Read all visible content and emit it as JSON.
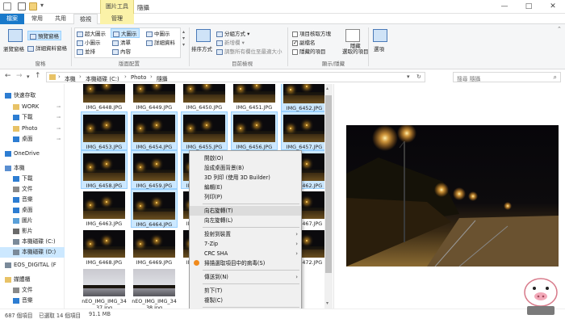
{
  "window": {
    "title": "隨攝",
    "context_tab": "圖片工具",
    "controls": [
      "—",
      "□",
      "✕"
    ]
  },
  "tabs": [
    {
      "label": "檔案"
    },
    {
      "label": "常用"
    },
    {
      "label": "共用"
    },
    {
      "label": "檢視"
    },
    {
      "label": "管理"
    }
  ],
  "ribbon": {
    "pane": {
      "nav_pane": "瀏覽窗格",
      "preview_pane": "預覽窗格",
      "details_pane": "詳細資料窗格",
      "group": "窗格"
    },
    "layout": {
      "options": [
        "超大圖示",
        "大圖示",
        "中圖示",
        "小圖示",
        "清單",
        "詳細資料",
        "並排",
        "內容"
      ],
      "selected": "大圖示",
      "group": "版面配置"
    },
    "current_view": {
      "sort_by": "排序方式",
      "group_by": "分組方式",
      "add_columns": "新增欄",
      "fit_columns": "調整所有欄位至最適大小",
      "group": "目前檢視"
    },
    "show_hide": {
      "item_checkboxes": "項目核取方塊",
      "file_extensions": "副檔名",
      "hidden_items": "隱藏的項目",
      "hide_selected": "隱藏\n選取的項目",
      "options": "選項",
      "group": "顯示/隱藏",
      "item_checkboxes_checked": false,
      "file_extensions_checked": true,
      "hidden_items_checked": false
    }
  },
  "address": {
    "path": [
      "本機",
      "本機磁碟 (C:)",
      "Photo",
      "隨攝"
    ],
    "search_placeholder": "搜尋 隨攝"
  },
  "nav": {
    "items": [
      {
        "label": "快速存取",
        "indent": 0,
        "icon": "star-icon",
        "color": "#2d7dd2"
      },
      {
        "label": "WORK",
        "indent": 1,
        "icon": "folder-icon",
        "color": "#e8c266"
      },
      {
        "label": "下載",
        "indent": 1,
        "icon": "download-icon",
        "color": "#2d7dd2"
      },
      {
        "label": "Photo",
        "indent": 1,
        "icon": "folder-icon",
        "color": "#e8c266"
      },
      {
        "label": "桌面",
        "indent": 1,
        "icon": "desktop-icon",
        "color": "#2d7dd2"
      },
      {
        "label": "OneDrive",
        "indent": 0,
        "icon": "cloud-icon",
        "color": "#2d7dd2"
      },
      {
        "label": "本機",
        "indent": 0,
        "icon": "computer-icon",
        "color": "#5a8ed0"
      },
      {
        "label": "下載",
        "indent": 1,
        "icon": "download-icon",
        "color": "#2d7dd2"
      },
      {
        "label": "文件",
        "indent": 1,
        "icon": "document-icon",
        "color": "#8a8a8a"
      },
      {
        "label": "音樂",
        "indent": 1,
        "icon": "music-icon",
        "color": "#2d7dd2"
      },
      {
        "label": "桌面",
        "indent": 1,
        "icon": "desktop-icon",
        "color": "#2d7dd2"
      },
      {
        "label": "圖片",
        "indent": 1,
        "icon": "pictures-icon",
        "color": "#5aa0d8"
      },
      {
        "label": "影片",
        "indent": 1,
        "icon": "video-icon",
        "color": "#6a6a6a"
      },
      {
        "label": "本機磁碟 (C:)",
        "indent": 1,
        "icon": "drive-icon",
        "color": "#7a8a9a"
      },
      {
        "label": "本機磁碟 (D:)",
        "indent": 1,
        "icon": "drive-icon",
        "color": "#7a8a9a"
      },
      {
        "label": "EOS_DIGITAL (F",
        "indent": 0,
        "icon": "drive-icon",
        "color": "#7a8a9a"
      },
      {
        "label": "媒體櫃",
        "indent": 0,
        "icon": "library-icon",
        "color": "#e8c266"
      },
      {
        "label": "文件",
        "indent": 1,
        "icon": "document-icon",
        "color": "#8a8a8a"
      },
      {
        "label": "音樂",
        "indent": 1,
        "icon": "music-icon",
        "color": "#2d7dd2"
      }
    ],
    "selected": "本機磁碟 (D:)"
  },
  "files": [
    {
      "name": "IMG_6448.JPG",
      "sel": false
    },
    {
      "name": "IMG_6449.JPG",
      "sel": false
    },
    {
      "name": "IMG_6450.JPG",
      "sel": false
    },
    {
      "name": "IMG_6451.JPG",
      "sel": false
    },
    {
      "name": "IMG_6452.JPG",
      "sel": true
    },
    {
      "name": "IMG_6453.JPG",
      "sel": true
    },
    {
      "name": "IMG_6454.JPG",
      "sel": true
    },
    {
      "name": "IMG_6455.JPG",
      "sel": true
    },
    {
      "name": "IMG_6456.JPG",
      "sel": true
    },
    {
      "name": "IMG_6457.JPG",
      "sel": true
    },
    {
      "name": "IMG_6458.JPG",
      "sel": true
    },
    {
      "name": "IMG_6459.JPG",
      "sel": true
    },
    {
      "name": "IMG_6460.JPG",
      "sel": true
    },
    {
      "name": "IMG_6461.JPG",
      "sel": true
    },
    {
      "name": "IMG_6462.JPG",
      "sel": true
    },
    {
      "name": "IMG_6463.JPG",
      "sel": false
    },
    {
      "name": "IMG_6464.JPG",
      "sel": true
    },
    {
      "name": "IMG_6465.JPG",
      "sel": false
    },
    {
      "name": "IMG_6466.JPG",
      "sel": false
    },
    {
      "name": "IMG_6467.JPG",
      "sel": false
    },
    {
      "name": "IMG_6468.JPG",
      "sel": false
    },
    {
      "name": "IMG_6469.JPG",
      "sel": false
    },
    {
      "name": "IMG_6470.JPG",
      "sel": false
    },
    {
      "name": "IMG_6471.JPG",
      "sel": false
    },
    {
      "name": "IMG_6472.JPG",
      "sel": false
    },
    {
      "name": "nEO_IMG_IMG_3437.jpg",
      "sel": false,
      "bright": true
    },
    {
      "name": "nEO_IMG_IMG_3438.jpg",
      "sel": false,
      "bright": true
    }
  ],
  "context_menu": [
    {
      "label": "開啟(O)"
    },
    {
      "label": "設成桌面背景(B)"
    },
    {
      "label": "3D 列印 (使用 3D Builder)"
    },
    {
      "label": "編輯(E)"
    },
    {
      "label": "列印(P)"
    },
    {
      "sep": true
    },
    {
      "label": "向右旋轉(T)",
      "hl": true
    },
    {
      "label": "向左旋轉(L)"
    },
    {
      "sep": true
    },
    {
      "label": "投射到裝置",
      "sub": true
    },
    {
      "label": "7-Zip",
      "sub": true
    },
    {
      "label": "CRC SHA",
      "sub": true
    },
    {
      "label": "掃描選取項目中的病毒(S)",
      "icon": true
    },
    {
      "sep": true
    },
    {
      "label": "傳送到(N)",
      "sub": true
    },
    {
      "sep": true
    },
    {
      "label": "剪下(T)"
    },
    {
      "label": "複製(C)"
    },
    {
      "sep": true
    },
    {
      "label": "建立捷徑(S)"
    }
  ],
  "status": {
    "count": "687 個項目",
    "selected": "已選取 14 個項目",
    "size": "91.1 MB"
  },
  "colors": {
    "accent": "#1979ca",
    "selection": "#cce8ff"
  }
}
